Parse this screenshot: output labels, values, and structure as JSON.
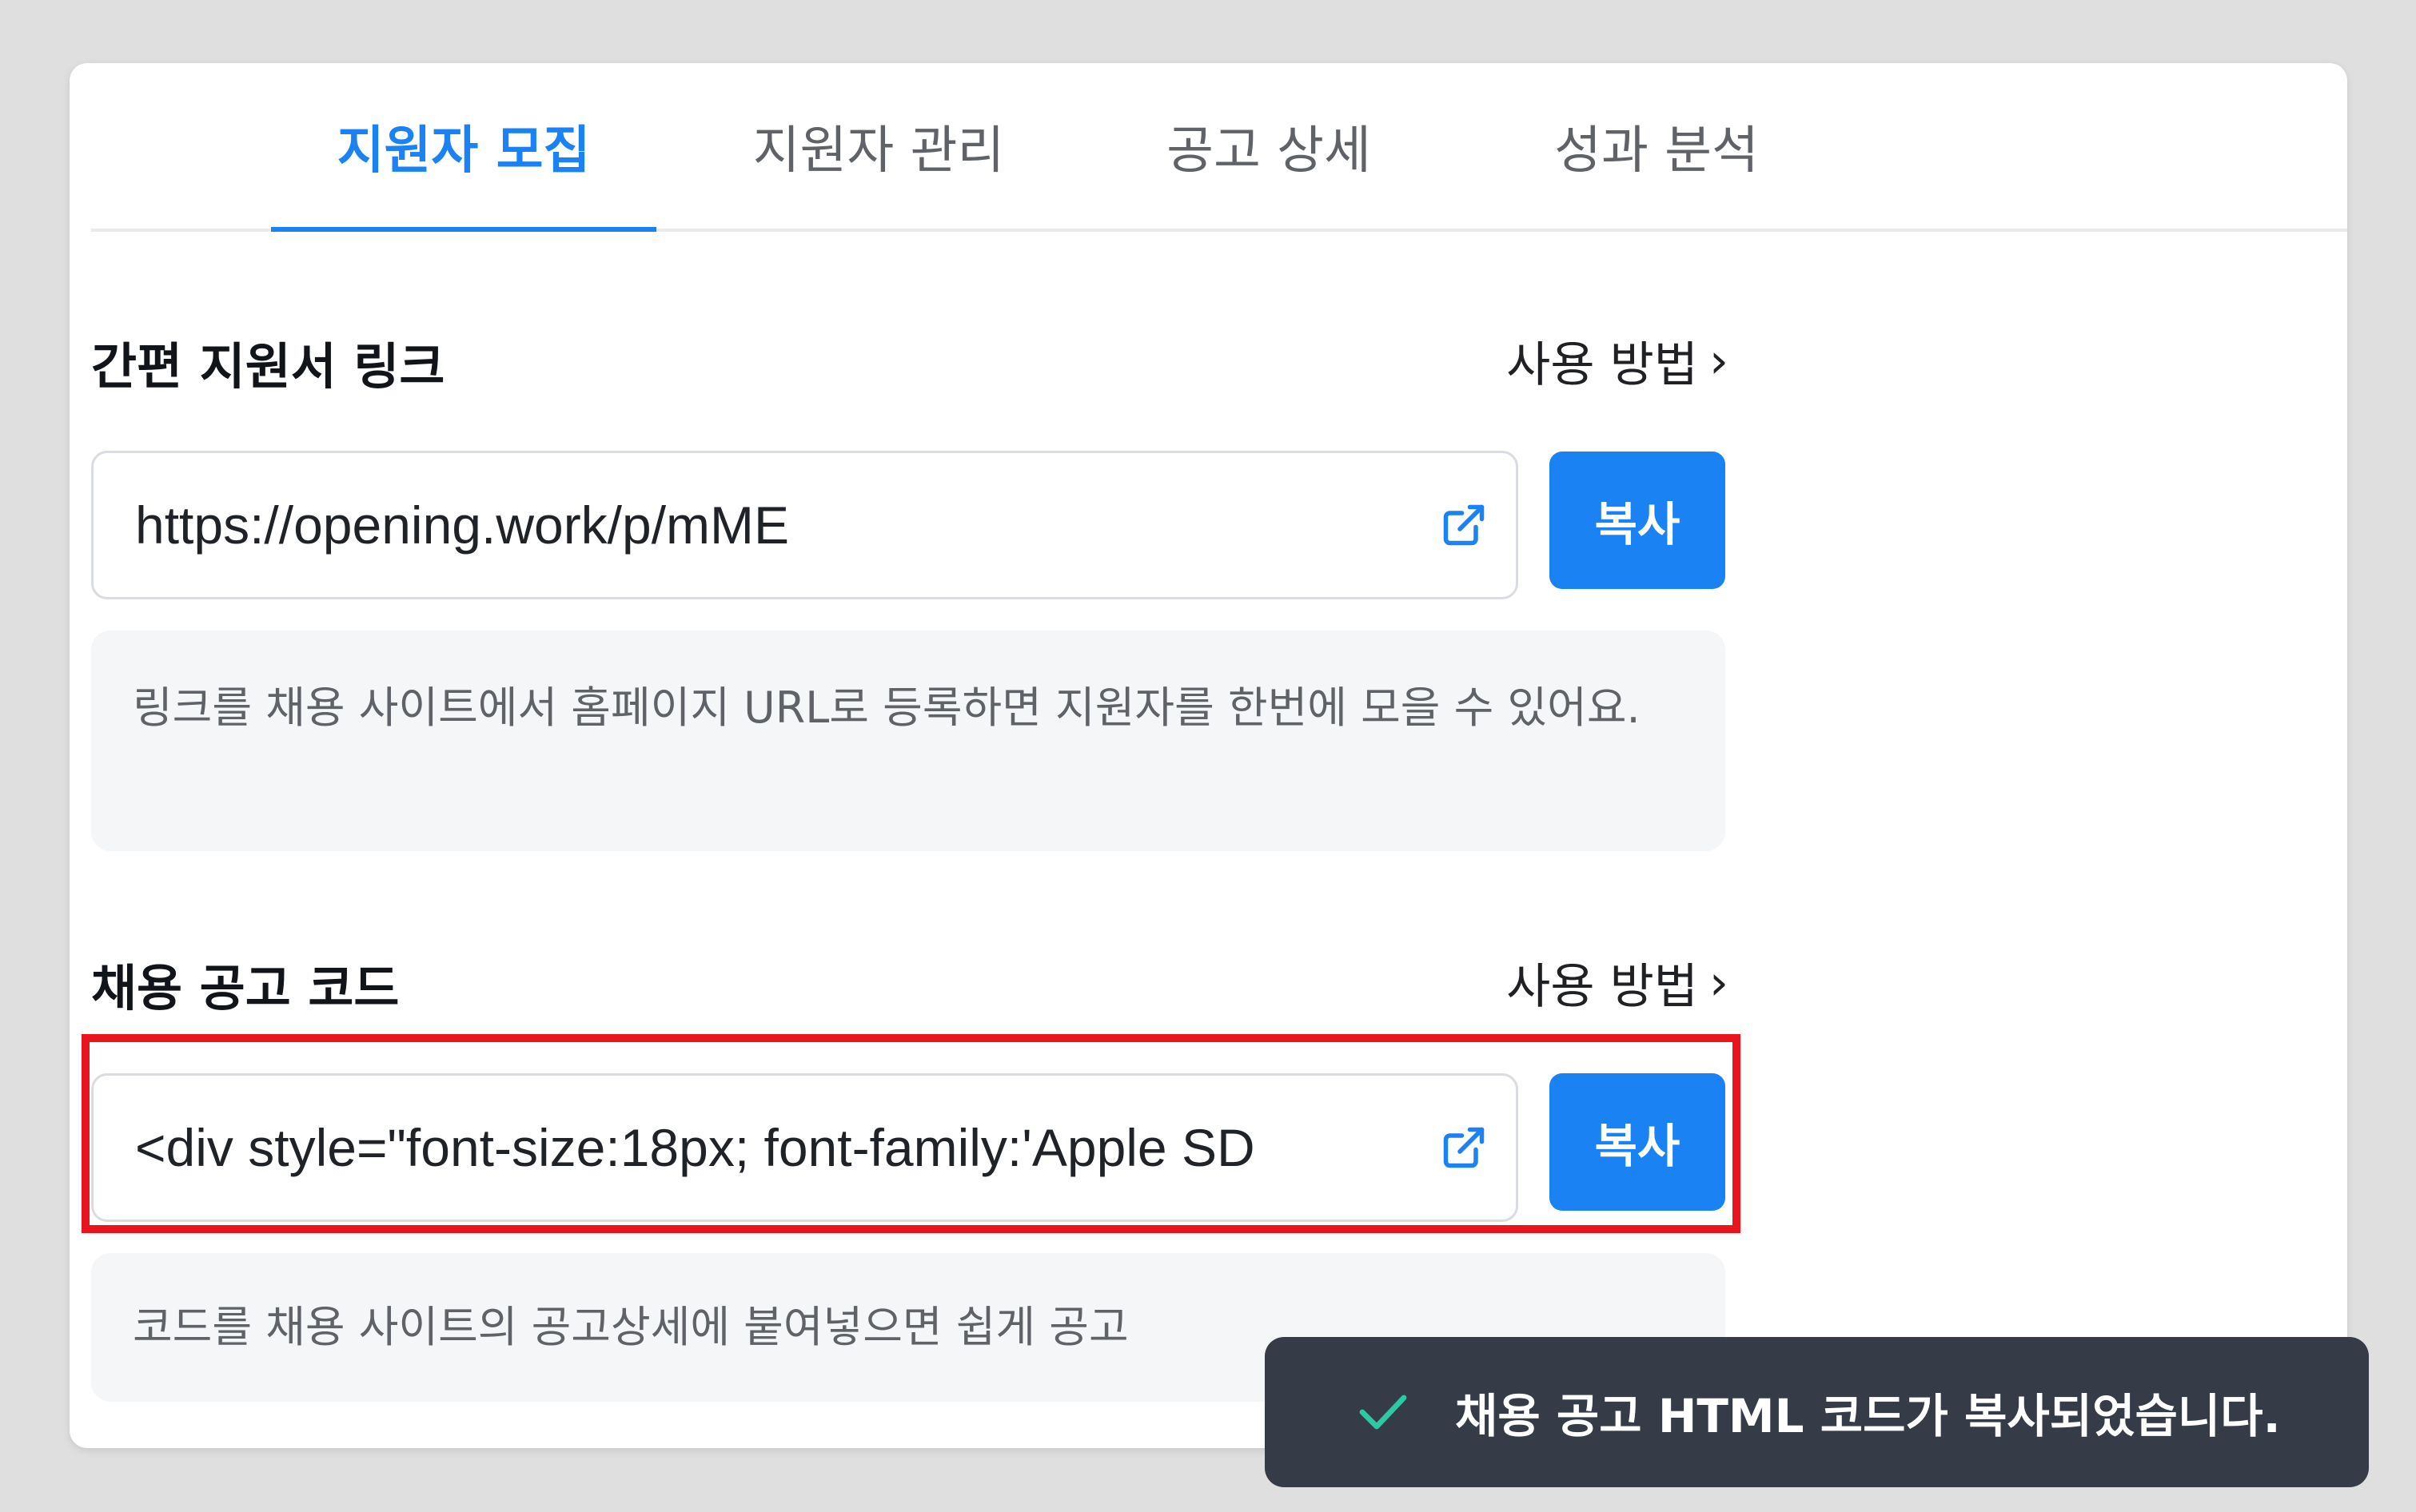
{
  "tabs": [
    {
      "label": "지원자 모집",
      "active": true
    },
    {
      "label": "지원자 관리",
      "active": false
    },
    {
      "label": "공고 상세",
      "active": false
    },
    {
      "label": "성과 분석",
      "active": false
    }
  ],
  "quick_link": {
    "title": "간편 지원서 링크",
    "howto": "사용 방법",
    "value": "https://opening.work/p/mME",
    "copy_label": "복사",
    "hint": "링크를 채용 사이트에서 홈페이지 URL로 등록하면 지원자를 한번에 모을 수 있어요."
  },
  "job_code": {
    "title": "채용 공고 코드",
    "howto": "사용 방법",
    "value": "<div style=\"font-size:18px; font-family:'Apple SD",
    "copy_label": "복사",
    "hint": "코드를 채용 사이트의 공고상세에 붙여넣으면 쉽게 공고"
  },
  "toast": {
    "message": "채용 공고 HTML 코드가 복사되었습니다.",
    "icon": "check-icon"
  },
  "colors": {
    "accent": "#1a82f2",
    "toast_bg": "#353c48",
    "check": "#2bc9a4",
    "highlight": "#e8141e"
  }
}
